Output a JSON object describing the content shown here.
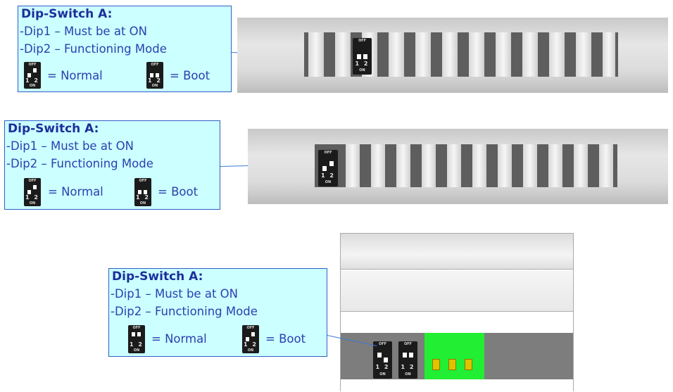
{
  "callouts": [
    {
      "title": "Dip-Switch A:",
      "line1": "-Dip1 – Must be at ON",
      "line2": "-Dip2 – Functioning Mode",
      "normal": "= Normal",
      "boot": "= Boot"
    },
    {
      "title": "Dip-Switch A:",
      "line1": "-Dip1 – Must be at ON",
      "line2": "-Dip2 – Functioning Mode",
      "normal": "= Normal",
      "boot": "= Boot"
    },
    {
      "title": "Dip-Switch A:",
      "line1": "-Dip1 – Must be at ON",
      "line2": "-Dip2 – Functioning Mode",
      "normal": "= Normal",
      "boot": "= Boot"
    }
  ],
  "dip": {
    "off": "OFF",
    "nums": "1 2",
    "on": "ON"
  },
  "colors": {
    "callout_bg": "#ccffff",
    "callout_border": "#2e5fc7",
    "title_text": "#1c2f9c",
    "body_text": "#2b3fb0",
    "terminal_green": "#22ee33"
  }
}
